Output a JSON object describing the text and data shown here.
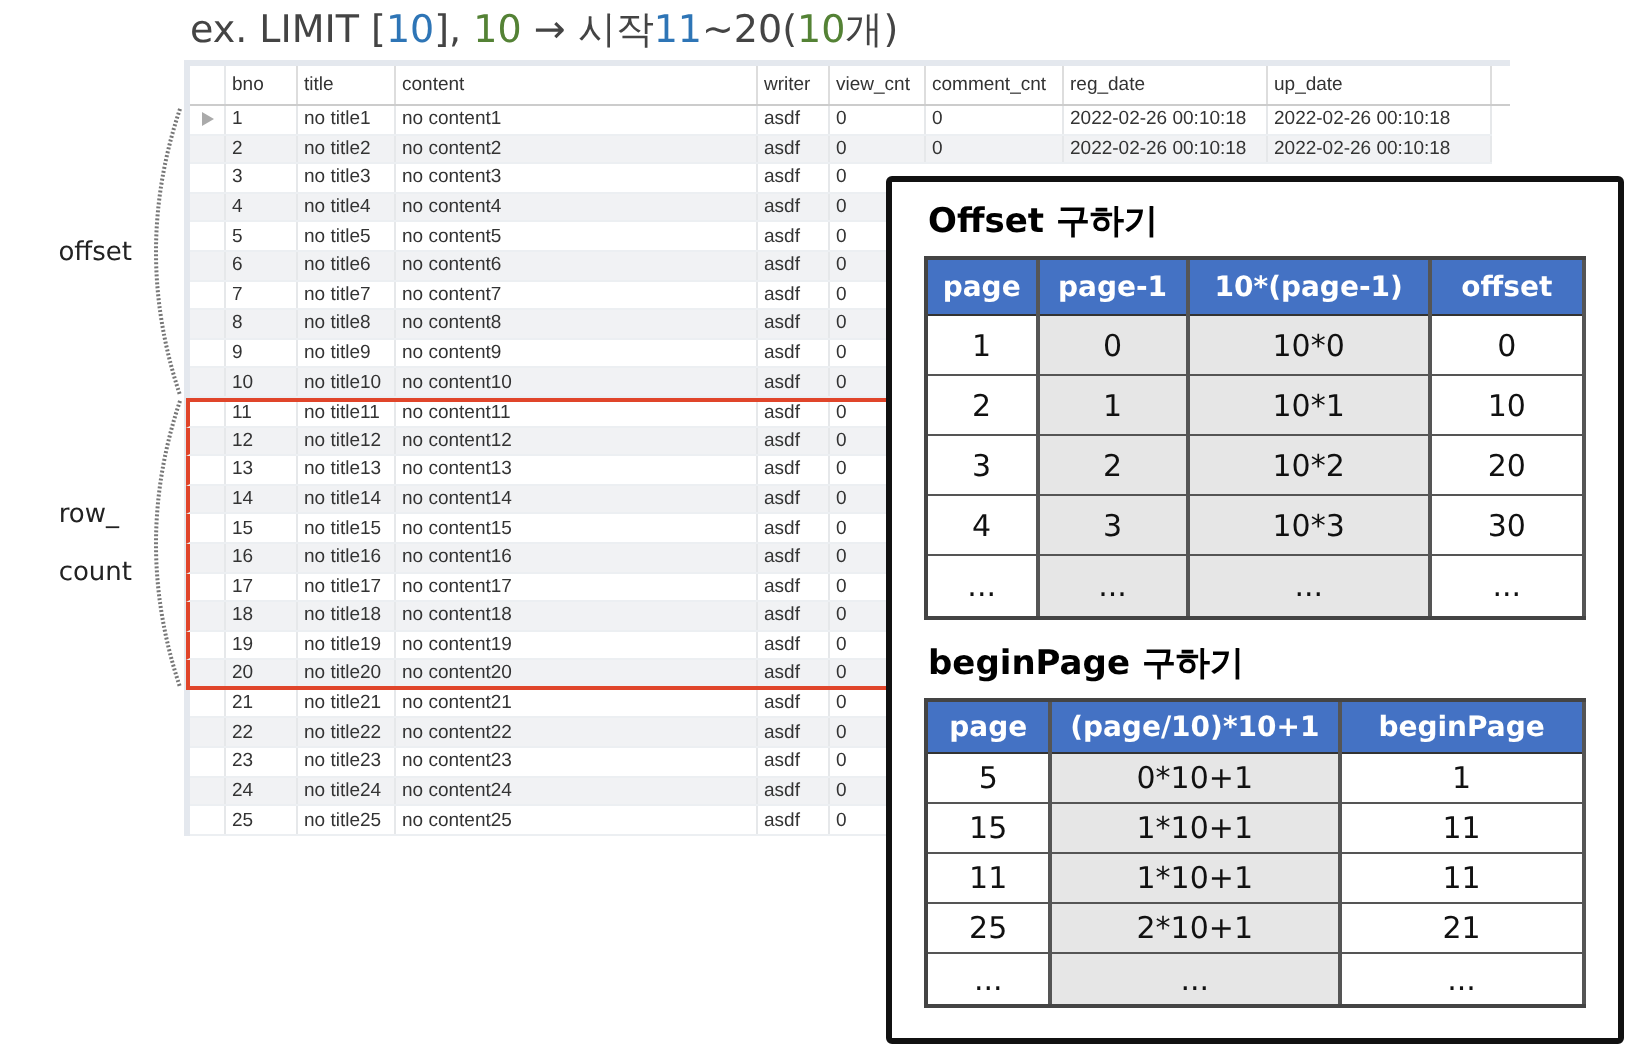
{
  "heading": {
    "segments": [
      {
        "text": "ex. LIMIT [",
        "color": "#444444"
      },
      {
        "text": "10",
        "color": "#2e75b6"
      },
      {
        "text": "], ",
        "color": "#444444"
      },
      {
        "text": "10",
        "color": "#548235"
      },
      {
        "text": " → 시작",
        "color": "#444444"
      },
      {
        "text": "11",
        "color": "#2e75b6"
      },
      {
        "text": "~20(",
        "color": "#444444"
      },
      {
        "text": "10",
        "color": "#548235"
      },
      {
        "text": "개)",
        "color": "#444444"
      }
    ]
  },
  "annotations": [
    {
      "lines": [
        "offset"
      ]
    },
    {
      "lines": [
        "row_",
        "count"
      ]
    }
  ],
  "result_grid": {
    "columns": [
      "bno",
      "title",
      "content",
      "writer",
      "view_cnt",
      "comment_cnt",
      "reg_date",
      "up_date"
    ],
    "rows": [
      {
        "selected": true,
        "highlighted": false,
        "cells": [
          "1",
          "no title1",
          "no content1",
          "asdf",
          "0",
          "0",
          "2022-02-26 00:10:18",
          "2022-02-26 00:10:18"
        ]
      },
      {
        "selected": false,
        "highlighted": false,
        "cells": [
          "2",
          "no title2",
          "no content2",
          "asdf",
          "0",
          "0",
          "2022-02-26 00:10:18",
          "2022-02-26 00:10:18"
        ]
      },
      {
        "selected": false,
        "highlighted": false,
        "cells": [
          "3",
          "no title3",
          "no content3",
          "asdf",
          "0"
        ]
      },
      {
        "selected": false,
        "highlighted": false,
        "cells": [
          "4",
          "no title4",
          "no content4",
          "asdf",
          "0"
        ]
      },
      {
        "selected": false,
        "highlighted": false,
        "cells": [
          "5",
          "no title5",
          "no content5",
          "asdf",
          "0"
        ]
      },
      {
        "selected": false,
        "highlighted": false,
        "cells": [
          "6",
          "no title6",
          "no content6",
          "asdf",
          "0"
        ]
      },
      {
        "selected": false,
        "highlighted": false,
        "cells": [
          "7",
          "no title7",
          "no content7",
          "asdf",
          "0"
        ]
      },
      {
        "selected": false,
        "highlighted": false,
        "cells": [
          "8",
          "no title8",
          "no content8",
          "asdf",
          "0"
        ]
      },
      {
        "selected": false,
        "highlighted": false,
        "cells": [
          "9",
          "no title9",
          "no content9",
          "asdf",
          "0"
        ]
      },
      {
        "selected": false,
        "highlighted": false,
        "cells": [
          "10",
          "no title10",
          "no content10",
          "asdf",
          "0"
        ]
      },
      {
        "selected": false,
        "highlighted": true,
        "cells": [
          "11",
          "no title11",
          "no content11",
          "asdf",
          "0"
        ]
      },
      {
        "selected": false,
        "highlighted": true,
        "cells": [
          "12",
          "no title12",
          "no content12",
          "asdf",
          "0"
        ]
      },
      {
        "selected": false,
        "highlighted": true,
        "cells": [
          "13",
          "no title13",
          "no content13",
          "asdf",
          "0"
        ]
      },
      {
        "selected": false,
        "highlighted": true,
        "cells": [
          "14",
          "no title14",
          "no content14",
          "asdf",
          "0"
        ]
      },
      {
        "selected": false,
        "highlighted": true,
        "cells": [
          "15",
          "no title15",
          "no content15",
          "asdf",
          "0"
        ]
      },
      {
        "selected": false,
        "highlighted": true,
        "cells": [
          "16",
          "no title16",
          "no content16",
          "asdf",
          "0"
        ]
      },
      {
        "selected": false,
        "highlighted": true,
        "cells": [
          "17",
          "no title17",
          "no content17",
          "asdf",
          "0"
        ]
      },
      {
        "selected": false,
        "highlighted": true,
        "cells": [
          "18",
          "no title18",
          "no content18",
          "asdf",
          "0"
        ]
      },
      {
        "selected": false,
        "highlighted": true,
        "cells": [
          "19",
          "no title19",
          "no content19",
          "asdf",
          "0"
        ]
      },
      {
        "selected": false,
        "highlighted": true,
        "cells": [
          "20",
          "no title20",
          "no content20",
          "asdf",
          "0"
        ]
      },
      {
        "selected": false,
        "highlighted": false,
        "cells": [
          "21",
          "no title21",
          "no content21",
          "asdf",
          "0"
        ]
      },
      {
        "selected": false,
        "highlighted": false,
        "cells": [
          "22",
          "no title22",
          "no content22",
          "asdf",
          "0"
        ]
      },
      {
        "selected": false,
        "highlighted": false,
        "cells": [
          "23",
          "no title23",
          "no content23",
          "asdf",
          "0"
        ]
      },
      {
        "selected": false,
        "highlighted": false,
        "cells": [
          "24",
          "no title24",
          "no content24",
          "asdf",
          "0"
        ]
      },
      {
        "selected": false,
        "highlighted": false,
        "cells": [
          "25",
          "no title25",
          "no content25",
          "asdf",
          "0"
        ]
      }
    ]
  },
  "panel": {
    "sections": [
      {
        "title": "Offset 구하기",
        "columns": [
          {
            "label": "page",
            "shaded": false
          },
          {
            "label": "page-1",
            "shaded": true
          },
          {
            "label": "10*(page-1)",
            "shaded": true
          },
          {
            "label": "offset",
            "shaded": false
          }
        ],
        "rows": [
          [
            "1",
            "0",
            "10*0",
            "0"
          ],
          [
            "2",
            "1",
            "10*1",
            "10"
          ],
          [
            "3",
            "2",
            "10*2",
            "20"
          ],
          [
            "4",
            "3",
            "10*3",
            "30"
          ],
          [
            "...",
            "...",
            "...",
            "..."
          ]
        ]
      },
      {
        "title": "beginPage 구하기",
        "columns": [
          {
            "label": "page",
            "shaded": false
          },
          {
            "label": "(page/10)*10+1",
            "shaded": true
          },
          {
            "label": "beginPage",
            "shaded": false
          }
        ],
        "rows": [
          [
            "5",
            "0*10+1",
            "1"
          ],
          [
            "15",
            "1*10+1",
            "11"
          ],
          [
            "11",
            "1*10+1",
            "11"
          ],
          [
            "25",
            "2*10+1",
            "21"
          ],
          [
            "...",
            "...",
            "..."
          ]
        ]
      }
    ]
  }
}
